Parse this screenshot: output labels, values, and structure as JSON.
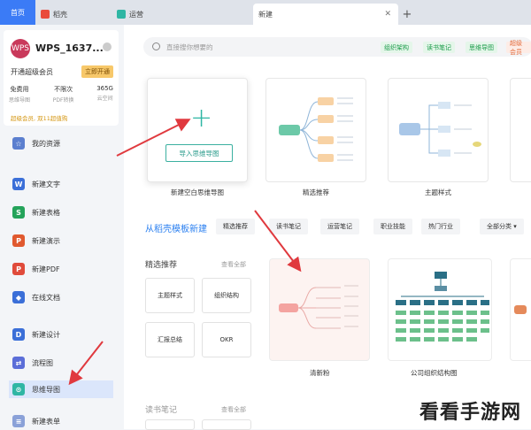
{
  "tabs": {
    "home": "首页",
    "daoke": "稻壳",
    "yunying": "运营",
    "new_tab": "新建"
  },
  "account": {
    "name": "WPS_1637...",
    "avatar_text": "WPS",
    "vip_text": "开通超级会员",
    "vip_button": "立即开通",
    "benefits": [
      {
        "value": "免费用",
        "label": "思维导图"
      },
      {
        "value": "不限次",
        "label": "PDF转换"
      },
      {
        "value": "365G",
        "label": "云空间"
      }
    ],
    "promo": "超级会员, 双11超值购"
  },
  "nav": [
    {
      "label": "我的资源",
      "color": "#5b7fcf",
      "glyph": "☆"
    },
    {
      "label": "新建文字",
      "color": "#3b6fd8",
      "glyph": "W"
    },
    {
      "label": "新建表格",
      "color": "#24a35a",
      "glyph": "S"
    },
    {
      "label": "新建演示",
      "color": "#e0592f",
      "glyph": "P"
    },
    {
      "label": "新建PDF",
      "color": "#e04b3b",
      "glyph": "P"
    },
    {
      "label": "在线文档",
      "color": "#3b6fd8",
      "glyph": "◆"
    },
    {
      "label": "新建设计",
      "color": "#3b6fd8",
      "glyph": "D"
    },
    {
      "label": "流程图",
      "color": "#5b6ed8",
      "glyph": "⇄"
    },
    {
      "label": "思维导图",
      "color": "#2fb6a4",
      "glyph": "⊙"
    },
    {
      "label": "新建表单",
      "color": "#8aa1d8",
      "glyph": "≡"
    }
  ],
  "search": {
    "placeholder": "直接搜你想要的",
    "chips": [
      "组织架构",
      "读书笔记",
      "思维导图",
      "超级会员"
    ]
  },
  "top_cards": {
    "blank_label": "新建空白思维导图",
    "import_label": "导入思维导图",
    "featured_label": "精选推荐",
    "theme_label": "主题样式"
  },
  "templates": {
    "title": "从稻壳模板新建",
    "filters": [
      "精选推荐",
      "读书笔记",
      "运营笔记",
      "职业技能",
      "热门行业",
      "全部分类 ▾"
    ],
    "section1": "精选推荐",
    "section2": "读书笔记",
    "view_all": "查看全部",
    "mini": [
      "主题样式",
      "组织结构",
      "汇报总结",
      "OKR"
    ],
    "card1_label": "清新粉",
    "card2_label": "公司组织结构图"
  },
  "watermark": "看看手游网"
}
